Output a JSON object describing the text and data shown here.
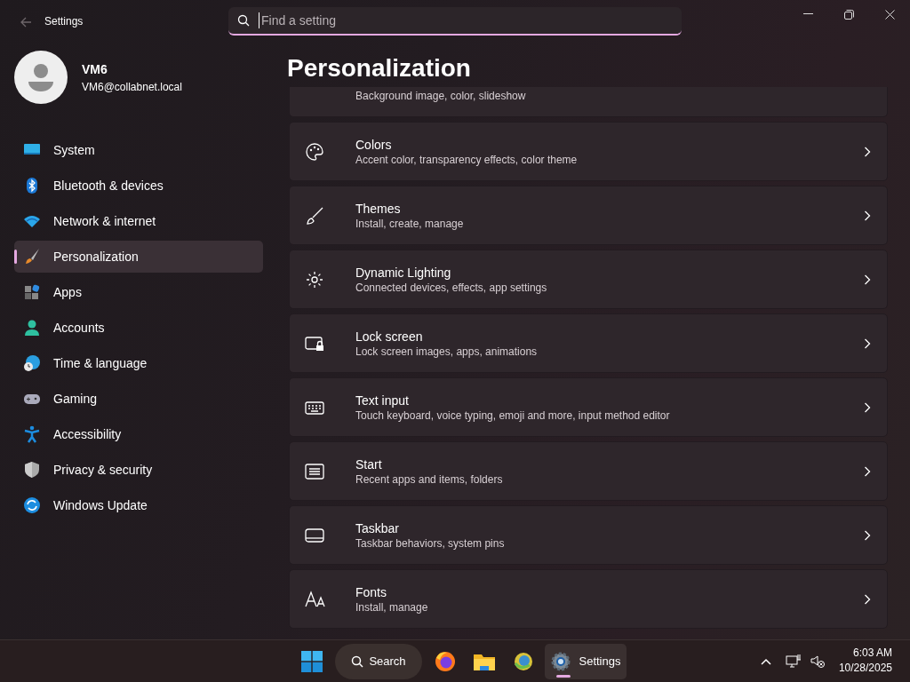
{
  "window": {
    "title": "Settings"
  },
  "search": {
    "placeholder": "Find a setting"
  },
  "user": {
    "name": "VM6",
    "email": "VM6@collabnet.local"
  },
  "sidebar": {
    "items": [
      {
        "label": "System",
        "selected": false
      },
      {
        "label": "Bluetooth & devices",
        "selected": false
      },
      {
        "label": "Network & internet",
        "selected": false
      },
      {
        "label": "Personalization",
        "selected": true
      },
      {
        "label": "Apps",
        "selected": false
      },
      {
        "label": "Accounts",
        "selected": false
      },
      {
        "label": "Time & language",
        "selected": false
      },
      {
        "label": "Gaming",
        "selected": false
      },
      {
        "label": "Accessibility",
        "selected": false
      },
      {
        "label": "Privacy & security",
        "selected": false
      },
      {
        "label": "Windows Update",
        "selected": false
      }
    ]
  },
  "page": {
    "title": "Personalization",
    "cards": [
      {
        "subtitle": "Background image, color, slideshow"
      },
      {
        "title": "Colors",
        "subtitle": "Accent color, transparency effects, color theme"
      },
      {
        "title": "Themes",
        "subtitle": "Install, create, manage"
      },
      {
        "title": "Dynamic Lighting",
        "subtitle": "Connected devices, effects, app settings"
      },
      {
        "title": "Lock screen",
        "subtitle": "Lock screen images, apps, animations"
      },
      {
        "title": "Text input",
        "subtitle": "Touch keyboard, voice typing, emoji and more, input method editor"
      },
      {
        "title": "Start",
        "subtitle": "Recent apps and items, folders"
      },
      {
        "title": "Taskbar",
        "subtitle": "Taskbar behaviors, system pins"
      },
      {
        "title": "Fonts",
        "subtitle": "Install, manage"
      }
    ]
  },
  "taskbar": {
    "search_label": "Search",
    "running_app": {
      "label": "Settings",
      "active": true
    },
    "time": "6:03 AM",
    "date": "10/28/2025"
  }
}
